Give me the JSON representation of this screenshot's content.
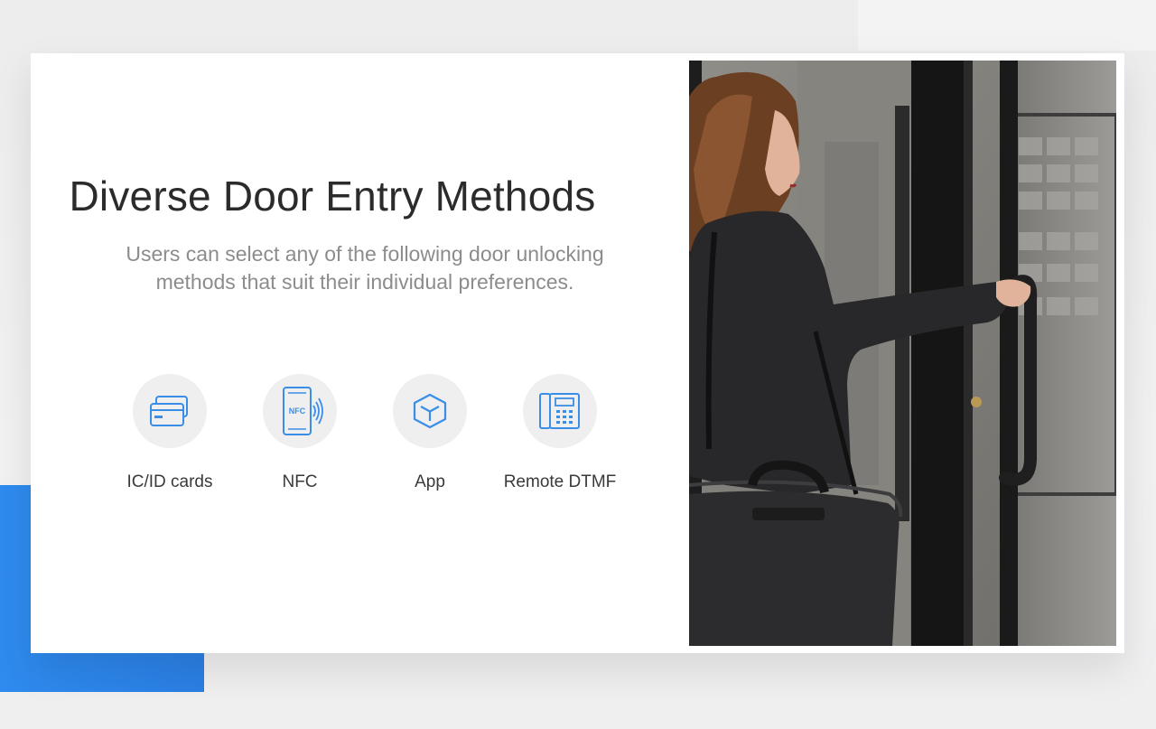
{
  "page": {
    "headline": "Diverse Door Entry Methods",
    "subtitle": "Users can select any of the following door unlocking methods that suit their individual preferences."
  },
  "methods": [
    {
      "label": "IC/ID cards",
      "icon": "id-card-icon"
    },
    {
      "label": "NFC",
      "icon": "nfc-phone-icon",
      "icon_text": "NFC"
    },
    {
      "label": "App",
      "icon": "app-cube-icon"
    },
    {
      "label": "Remote DTMF",
      "icon": "desk-phone-icon"
    }
  ],
  "photo": {
    "subject": "woman-opening-glass-door-photo"
  },
  "colors": {
    "accent_blue": "#2f8bef",
    "icon_blue": "#3a8ee8",
    "headline": "#2b2b2b",
    "subtitle": "#8c8c8c",
    "icon_circle": "#efefef"
  }
}
